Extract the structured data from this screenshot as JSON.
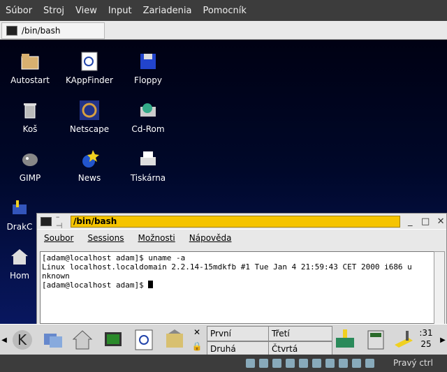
{
  "host_menu": [
    "Súbor",
    "Stroj",
    "View",
    "Input",
    "Zariadenia",
    "Pomocník"
  ],
  "top_task": {
    "label": "/bin/bash"
  },
  "desktop_icons": [
    {
      "label": "Autostart",
      "icon": "folder-icon"
    },
    {
      "label": "KAppFinder",
      "icon": "appfinder-icon"
    },
    {
      "label": "Floppy",
      "icon": "floppy-icon"
    },
    {
      "label": "Koš",
      "icon": "trash-icon"
    },
    {
      "label": "Netscape",
      "icon": "netscape-icon"
    },
    {
      "label": "Cd-Rom",
      "icon": "cdrom-icon"
    },
    {
      "label": "GIMP",
      "icon": "gimp-icon"
    },
    {
      "label": "News",
      "icon": "news-icon"
    },
    {
      "label": "Tiskárna",
      "icon": "printer-icon"
    },
    {
      "label": "DrakC",
      "icon": "drakconf-icon"
    },
    {
      "label": "Hom",
      "icon": "home-icon"
    }
  ],
  "konsole": {
    "title": "/bin/bash",
    "menu": [
      "Soubor",
      "Sessions",
      "Možnosti",
      "Nápověda"
    ],
    "lines": [
      "[adam@localhost adam]$ uname -a",
      "Linux localhost.localdomain 2.2.14-15mdkfb #1 Tue Jan 4 21:59:43 CET 2000 i686 u",
      "nknown",
      "[adam@localhost adam]$ "
    ]
  },
  "panel": {
    "desktops": [
      "První",
      "Třetí",
      "Druhá",
      "Čtvrtá"
    ],
    "clock": {
      "hour": ":31",
      "min": "25"
    }
  },
  "statusbar": {
    "host_key": "Pravý ctrl"
  }
}
